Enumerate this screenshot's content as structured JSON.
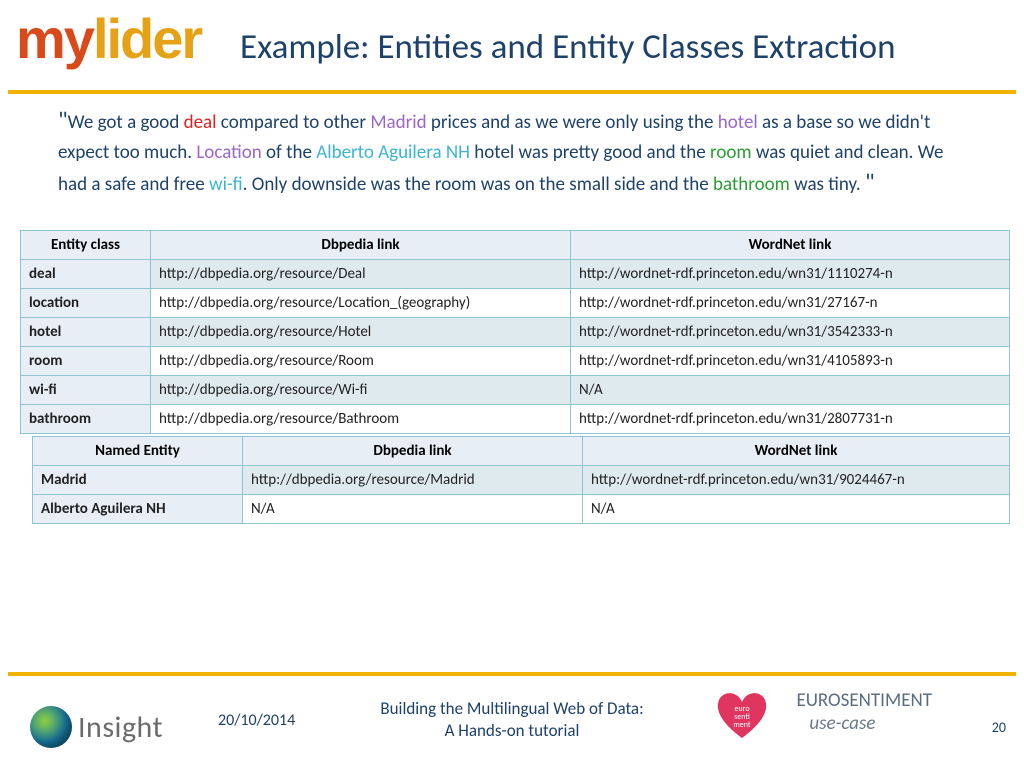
{
  "logo": {
    "part1": "my",
    "part2": "lider"
  },
  "title": "Example: Entities and Entity Classes Extraction",
  "review": {
    "t1": "We got a good ",
    "w1": "deal",
    "t2": " compared to other ",
    "w2": "Madrid",
    "t3": " prices and as we were only using the ",
    "w3": "hotel",
    "t4": " as a base so we didn't expect too much. ",
    "w4": "Location",
    "t5": " of the ",
    "w5": "Alberto Aguilera NH",
    "t6": " hotel was pretty good and the ",
    "w6": "room",
    "t7": " was quiet and clean. We had a safe and free ",
    "w7": "wi-fi",
    "t8": ". Only downside was the room was on the small side and the ",
    "w8": "bathroom",
    "t9": " was tiny. "
  },
  "table1": {
    "headers": [
      "Entity class",
      "Dbpedia link",
      "WordNet link"
    ],
    "rows": [
      {
        "label": "deal",
        "dbpedia": " http://dbpedia.org/resource/Deal",
        "wordnet": "http://wordnet-rdf.princeton.edu/wn31/1110274-n"
      },
      {
        "label": "location",
        "dbpedia": "http://dbpedia.org/resource/Location_(geography)",
        "wordnet": "http://wordnet-rdf.princeton.edu/wn31/27167-n"
      },
      {
        "label": "hotel",
        "dbpedia": "http://dbpedia.org/resource/Hotel",
        "wordnet": "http://wordnet-rdf.princeton.edu/wn31/3542333-n"
      },
      {
        "label": "room",
        "dbpedia": "http://dbpedia.org/resource/Room",
        "wordnet": "http://wordnet-rdf.princeton.edu/wn31/4105893-n"
      },
      {
        "label": "wi-fi",
        "dbpedia": " http://dbpedia.org/resource/Wi-fi",
        "wordnet": "N/A"
      },
      {
        "label": "bathroom",
        "dbpedia": "http://dbpedia.org/resource/Bathroom",
        "wordnet": "http://wordnet-rdf.princeton.edu/wn31/2807731-n"
      }
    ]
  },
  "table2": {
    "headers": [
      "Named Entity",
      "Dbpedia link",
      "WordNet link"
    ],
    "rows": [
      {
        "label": "Madrid",
        "dbpedia": " http://dbpedia.org/resource/Madrid",
        "wordnet": "http://wordnet-rdf.princeton.edu/wn31/9024467-n"
      },
      {
        "label": "Alberto Aguilera NH",
        "dbpedia": "N/A",
        "wordnet": "N/A"
      }
    ]
  },
  "footer": {
    "insight": "Insight",
    "date": "20/10/2014",
    "center1": "Building the Multilingual Web of Data:",
    "center2": "A Hands-on tutorial",
    "heart_label": "euro senti ment",
    "euro1": "EUROSENTIMENT",
    "euro2": "use-case",
    "page": "20"
  }
}
